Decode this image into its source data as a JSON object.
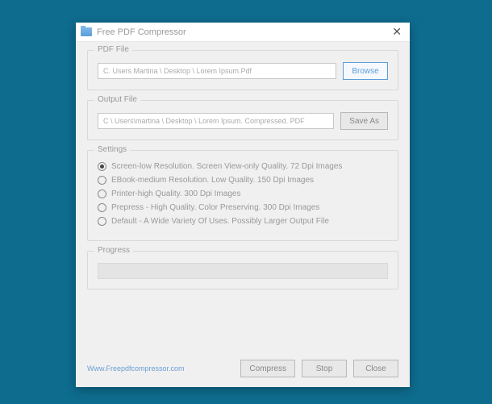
{
  "window": {
    "title": "Free PDF Compressor"
  },
  "pdf_file": {
    "legend": "PDF File",
    "path": "C. Users Martina \\ Desktop \\ Lorem Ipsum.Pdf",
    "browse": "Browse"
  },
  "output_file": {
    "legend": "Output File",
    "path": "C \\ Users\\martina \\ Desktop \\ Lorem Ipsum. Compressed. PDF",
    "save_as": "Save As"
  },
  "settings": {
    "legend": "Settings",
    "options": [
      "Screen-low Resolution. Screen View-only Quality. 72 Dpi Images",
      "EBook-medium Resolution. Low Quality. 150 Dpi Images",
      "Printer-high Quality. 300 Dpi Images",
      "Prepress - High Quality. Color Preserving. 300 Dpi Images",
      "Default - A Wide Variety Of Uses. Possibly Larger Output File"
    ],
    "selected": 0
  },
  "progress": {
    "legend": "Progress"
  },
  "footer": {
    "link": "Www.Freepdfcompressor.com",
    "compress": "Compress",
    "stop": "Stop",
    "close": "Close"
  }
}
